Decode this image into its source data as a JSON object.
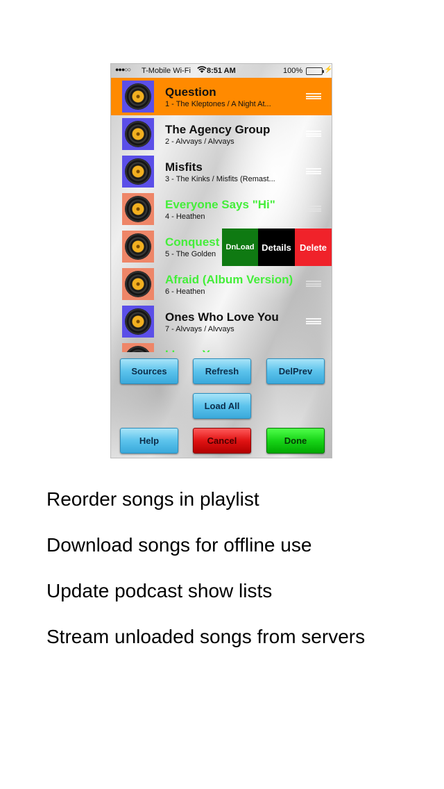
{
  "status_bar": {
    "signal": "●●●○○",
    "carrier": "T-Mobile Wi-Fi",
    "time": "8:51 AM",
    "battery_pct": "100%",
    "battery_level": 1.0,
    "charging_icon": "⚡"
  },
  "songs": [
    {
      "title": "Question",
      "subtitle": "1 - The Kleptones / A Night At...",
      "art": "blue",
      "title_color": "default",
      "selected": true
    },
    {
      "title": "The Agency Group",
      "subtitle": "2 - Alvvays / Alvvays",
      "art": "blue",
      "title_color": "default",
      "selected": false
    },
    {
      "title": "Misfits",
      "subtitle": "3 - The Kinks / Misfits (Remast...",
      "art": "blue",
      "title_color": "default",
      "selected": false
    },
    {
      "title": "Everyone Says \"Hi\"",
      "subtitle": "4 - Heathen",
      "art": "salmon",
      "title_color": "green",
      "selected": false
    },
    {
      "title": "Conquest",
      "subtitle": "5 - The Golden",
      "art": "salmon",
      "title_color": "green",
      "selected": false
    },
    {
      "title": "Afraid (Album Version)",
      "subtitle": "6 - Heathen",
      "art": "salmon",
      "title_color": "green",
      "selected": false
    },
    {
      "title": "Ones Who Love You",
      "subtitle": "7 - Alvvays / Alvvays",
      "art": "blue",
      "title_color": "default",
      "selected": false
    },
    {
      "title": "I Love You",
      "subtitle": "",
      "art": "salmon",
      "title_color": "green",
      "selected": false
    }
  ],
  "swipe_actions": {
    "dnload": "DnLoad",
    "details": "Details",
    "delete": "Delete"
  },
  "buttons": {
    "sources": "Sources",
    "refresh": "Refresh",
    "delprev": "DelPrev",
    "load_all": "Load All",
    "help": "Help",
    "cancel": "Cancel",
    "done": "Done"
  },
  "features": [
    "Reorder songs in playlist",
    "Download songs for offline use",
    "Update podcast show lists",
    "Stream unloaded songs from servers"
  ],
  "colors": {
    "selected_row": "#ff8a00",
    "downloaded_title": "#44ee3a",
    "art_blue": "#5b4fe8",
    "art_salmon": "#ee8668",
    "dnload_bg": "#0f7a12",
    "details_bg": "#000000",
    "delete_bg": "#f0222a"
  }
}
